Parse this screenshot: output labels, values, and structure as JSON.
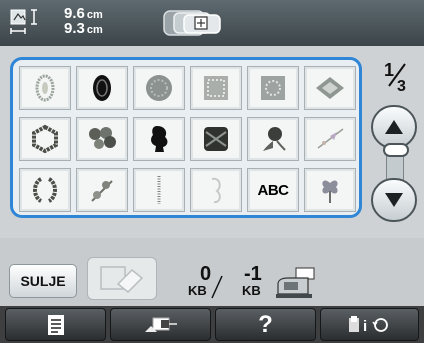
{
  "header": {
    "width_value": "9.6",
    "width_unit": "cm",
    "height_value": "9.3",
    "height_unit": "cm",
    "size_icon": "embroidery-size-icon",
    "hoop_icon": "hoop-frame-icon"
  },
  "pattern_grid": {
    "items": [
      {
        "icon": "oval-lace-pattern"
      },
      {
        "icon": "black-oval-frame-pattern"
      },
      {
        "icon": "round-lace-doily-pattern"
      },
      {
        "icon": "square-lace-pattern"
      },
      {
        "icon": "square-lace-pattern-2"
      },
      {
        "icon": "diamond-lace-pattern"
      },
      {
        "icon": "floral-wreath-pattern"
      },
      {
        "icon": "bouquet-pattern"
      },
      {
        "icon": "lady-silhouette-pattern"
      },
      {
        "icon": "ornate-pattern"
      },
      {
        "icon": "rose-pattern"
      },
      {
        "icon": "bird-branch-pattern"
      },
      {
        "icon": "leaf-wreath-pattern"
      },
      {
        "icon": "flower-branch-pattern"
      },
      {
        "icon": "vertical-border-pattern"
      },
      {
        "icon": "pale-ornament-pattern"
      },
      {
        "icon": "text-pattern",
        "label": "ABC"
      },
      {
        "icon": "butterfly-flower-pattern"
      }
    ]
  },
  "paging": {
    "current": "1",
    "total": "3",
    "up_icon": "up-arrow-icon",
    "down_icon": "down-arrow-icon"
  },
  "actions": {
    "close_label": "SULJE",
    "delete_icon": "eraser-icon",
    "memory_value": "0",
    "memory_unit": "KB",
    "pattern_value": "-1",
    "pattern_unit": "KB",
    "machine_icon": "embroidery-machine-icon"
  },
  "footer": {
    "help_label": "?",
    "items": [
      "page-icon",
      "hoop-view-icon",
      "help",
      "settings-info-icon"
    ]
  },
  "colors": {
    "header_bg": "#3c4549",
    "grid_border": "#2f86d6",
    "footer_bg": "#3d3f41"
  }
}
